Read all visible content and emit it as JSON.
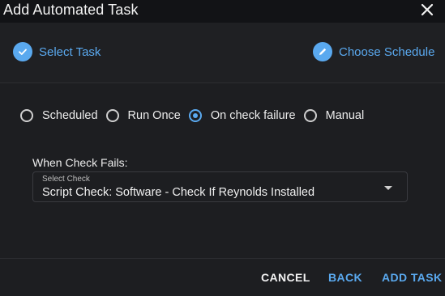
{
  "dialog": {
    "title": "Add Automated Task",
    "close_icon": "close-icon"
  },
  "stepper": {
    "steps": [
      {
        "label": "Select Task",
        "icon": "check-icon",
        "state": "complete"
      },
      {
        "label": "Choose Schedule",
        "icon": "pencil-icon",
        "state": "active"
      }
    ]
  },
  "trigger": {
    "options": [
      {
        "label": "Scheduled",
        "checked": false
      },
      {
        "label": "Run Once",
        "checked": false
      },
      {
        "label": "On check failure",
        "checked": true
      },
      {
        "label": "Manual",
        "checked": false
      }
    ]
  },
  "check_section": {
    "label": "When Check Fails:",
    "select_caption": "Select Check",
    "select_value": "Script Check: Software - Check If Reynolds Installed"
  },
  "actions": {
    "cancel": "CANCEL",
    "back": "BACK",
    "add_task": "ADD TASK"
  },
  "colors": {
    "accent": "#5aa9ef",
    "background": "#1d1e21",
    "titlebar": "#121316"
  }
}
